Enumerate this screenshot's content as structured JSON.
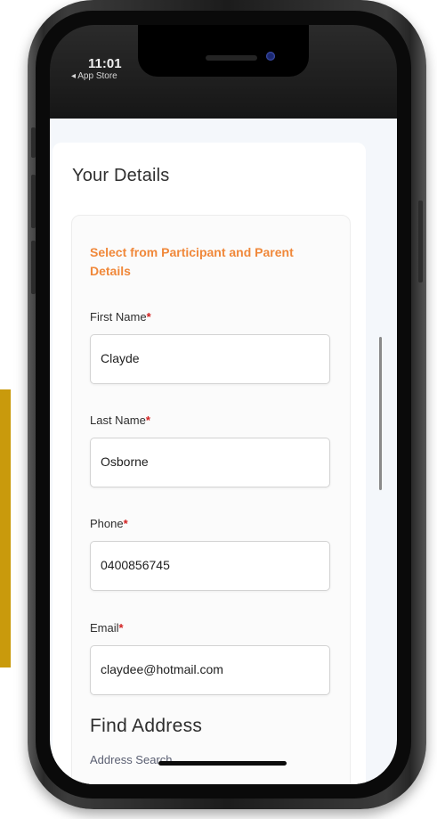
{
  "status_bar": {
    "time": "11:01",
    "back_app": "◂ App Store"
  },
  "page": {
    "title": "Your Details",
    "select_link": "Select from Participant and Parent Details"
  },
  "fields": [
    {
      "label": "First Name",
      "required_mark": "*",
      "value": "Clayde"
    },
    {
      "label": "Last Name",
      "required_mark": "*",
      "value": "Osborne"
    },
    {
      "label": "Phone",
      "required_mark": "*",
      "value": "0400856745"
    },
    {
      "label": "Email",
      "required_mark": "*",
      "value": "claydee@hotmail.com"
    }
  ],
  "address": {
    "heading": "Find Address",
    "search_label": "Address Search"
  },
  "colors": {
    "accent_orange": "#f0883a",
    "required_red": "#d32121",
    "side_accent": "#c99a0c"
  }
}
